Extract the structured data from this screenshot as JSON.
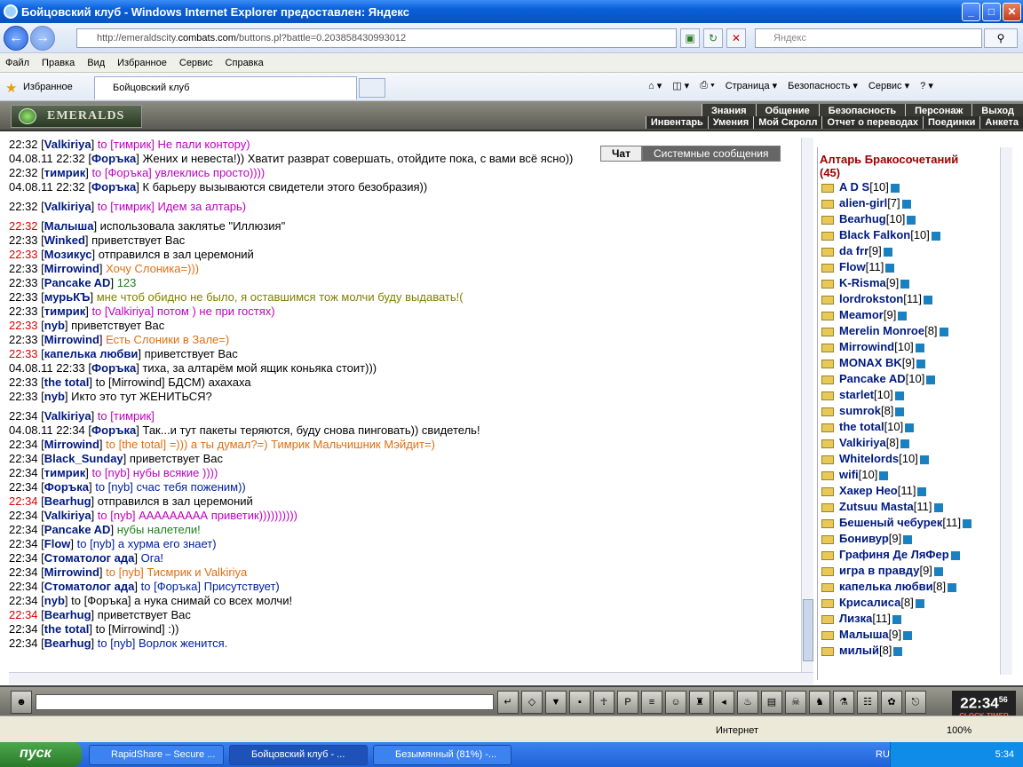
{
  "window": {
    "title": "Бойцовский клуб - Windows Internet Explorer предоставлен: Яндекс",
    "url_prefix": "http://emeraldscity.",
    "url_domain": "combats.com",
    "url_suffix": "/buttons.pl?battle=0.203858430993012",
    "search_placeholder": "Яндекс"
  },
  "menu": [
    "Файл",
    "Правка",
    "Вид",
    "Избранное",
    "Сервис",
    "Справка"
  ],
  "favorites_label": "Избранное",
  "tab_label": "Бойцовский клуб",
  "cmdbar": [
    "Страница ▾",
    "Безопасность ▾",
    "Сервис ▾"
  ],
  "game": {
    "logo": "EMERALDS",
    "menu1": [
      "Знания",
      "Общение",
      "Безопасность",
      "Персонаж",
      "Выход"
    ],
    "menu2": [
      "Инвентарь",
      "Умения",
      "Мой Скролл",
      "Отчет о переводах",
      "Поединки",
      "Анкета"
    ],
    "tabs": [
      "Чат",
      "Системные сообщения"
    ]
  },
  "chat": [
    {
      "t": "22:32",
      "r": false,
      "nick": "Valkiriya",
      "to": "to [тимрик]",
      "msg": "Не пали контору)",
      "mc": "#c000c0"
    },
    {
      "t": "04.08.11 22:32",
      "r": false,
      "nick": "Форъка",
      "to": "",
      "msg": "Жених и невеста!)) Хватит разврат совершать, отойдите пока, с вами всё ясно))",
      "mc": "#000"
    },
    {
      "t": "22:32",
      "r": false,
      "nick": "тимрик",
      "to": "to [Форъка]",
      "msg": "увлеклись просто))))",
      "mc": "#c000c0"
    },
    {
      "t": "04.08.11 22:32",
      "r": false,
      "nick": "Форъка",
      "to": "",
      "msg": "К барьеру вызываются свидетели этого безобразия))",
      "mc": "#000"
    },
    {
      "t": "22:32",
      "r": false,
      "nick": "Valkiriya",
      "to": "to [тимрик]",
      "msg": "Идем за алтарь)",
      "mc": "#c000c0",
      "gap": true
    },
    {
      "t": "22:32",
      "r": true,
      "nick": "Малыша",
      "to": "",
      "msg": "использовала заклятье \"Иллюзия\"",
      "mc": "#000",
      "gap": true
    },
    {
      "t": "22:33",
      "r": false,
      "nick": "Winked",
      "to": "",
      "msg": "приветствует Вас",
      "mc": "#000"
    },
    {
      "t": "22:33",
      "r": true,
      "nick": "Мозикус",
      "to": "",
      "msg": "отправился в зал церемоний",
      "mc": "#000"
    },
    {
      "t": "22:33",
      "r": false,
      "nick": "Mirrowind",
      "to": "",
      "msg": "Хочу Слоника=)))",
      "mc": "#e07010"
    },
    {
      "t": "22:33",
      "r": false,
      "nick": "Pancake AD",
      "to": "",
      "msg": "123",
      "mc": "#208020"
    },
    {
      "t": "22:33",
      "r": false,
      "nick": "мурьКЪ",
      "to": "",
      "msg": "мне чтоб обидно не было, я оставшимся тож молчи буду выдавать!(",
      "mc": "#808000"
    },
    {
      "t": "22:33",
      "r": false,
      "nick": "тимрик",
      "to": "to [Valkiriya]",
      "msg": "потом ) не при гостях)",
      "mc": "#c000c0"
    },
    {
      "t": "22:33",
      "r": true,
      "nick": "nyb",
      "to": "",
      "msg": "приветствует Вас",
      "mc": "#000"
    },
    {
      "t": "22:33",
      "r": false,
      "nick": "Mirrowind",
      "to": "",
      "msg": "Есть Слоники в Зале=)",
      "mc": "#e07010"
    },
    {
      "t": "22:33",
      "r": true,
      "nick": "капелька любви",
      "to": "",
      "msg": "приветствует Вас",
      "mc": "#000"
    },
    {
      "t": "04.08.11 22:33",
      "r": false,
      "nick": "Форъка",
      "to": "",
      "msg": "тиха, за алтарём мой ящик коньяка стоит)))",
      "mc": "#000"
    },
    {
      "t": "22:33",
      "r": false,
      "nick": "the total",
      "to": "to [Mirrowind]",
      "msg": "БДСМ) ахахаха",
      "mc": "#000"
    },
    {
      "t": "22:33",
      "r": false,
      "nick": "nyb",
      "to": "",
      "msg": "Икто это тут ЖЕНИТЬСЯ?",
      "mc": "#000"
    },
    {
      "t": "22:34",
      "r": false,
      "nick": "Valkiriya",
      "to": "to [тимрик]",
      "msg": "",
      "mc": "#c000c0",
      "gap": true
    },
    {
      "t": "04.08.11 22:34",
      "r": false,
      "nick": "Форъка",
      "to": "",
      "msg": "Так...и тут пакеты теряются, буду снова пинговать)) свидетель!",
      "mc": "#000"
    },
    {
      "t": "22:34",
      "r": false,
      "nick": "Mirrowind",
      "to": "to [the total]",
      "msg": "=))) а ты думал?=) Тимрик Мальчишник Мэйдит=)",
      "mc": "#e07010"
    },
    {
      "t": "22:34",
      "r": false,
      "nick": "Black_Sunday",
      "to": "",
      "msg": "приветствует Вас",
      "mc": "#000"
    },
    {
      "t": "22:34",
      "r": false,
      "nick": "тимрик",
      "to": "to [nyb]",
      "msg": "нубы всякие ))))",
      "mc": "#c000c0"
    },
    {
      "t": "22:34",
      "r": false,
      "nick": "Форъка",
      "to": "to [nyb]",
      "msg": "счас тебя поженим))",
      "mc": "#0020a0"
    },
    {
      "t": "22:34",
      "r": true,
      "nick": "Bearhug",
      "to": "",
      "msg": "отправился в зал церемоний",
      "mc": "#000"
    },
    {
      "t": "22:34",
      "r": false,
      "nick": "Valkiriya",
      "to": "to [nyb]",
      "msg": "ААААААААА приветик))))))))))",
      "mc": "#c000c0"
    },
    {
      "t": "22:34",
      "r": false,
      "nick": "Pancake AD",
      "to": "",
      "msg": "нубы налетели!",
      "mc": "#208020"
    },
    {
      "t": "22:34",
      "r": false,
      "nick": "Flow",
      "to": "to [nyb]",
      "msg": "а хурма его знает)",
      "mc": "#0020a0"
    },
    {
      "t": "22:34",
      "r": false,
      "nick": "Стоматолог ада",
      "to": "",
      "msg": "Ога!",
      "mc": "#0020a0"
    },
    {
      "t": "22:34",
      "r": false,
      "nick": "Mirrowind",
      "to": "to [nyb]",
      "msg": "Тисмрик и Valkiriya",
      "mc": "#e07010"
    },
    {
      "t": "22:34",
      "r": false,
      "nick": "Стоматолог ада",
      "to": "to [Форъка]",
      "msg": "Присутствует)",
      "mc": "#0020a0"
    },
    {
      "t": "22:34",
      "r": false,
      "nick": "nyb",
      "to": "to [Форъка]",
      "msg": "а нука снимай со всех молчи!",
      "mc": "#000"
    },
    {
      "t": "22:34",
      "r": true,
      "nick": "Bearhug",
      "to": "",
      "msg": "приветствует Вас",
      "mc": "#000"
    },
    {
      "t": "22:34",
      "r": false,
      "nick": "the total",
      "to": "to [Mirrowind]",
      "msg": ":))",
      "mc": "#000"
    },
    {
      "t": "22:34",
      "r": false,
      "nick": "Bearhug",
      "to": "to [nyb]",
      "msg": "Ворлок женится.",
      "mc": "#0020a0"
    }
  ],
  "room": {
    "title": "Алтарь Бракосочетаний",
    "count": "(45)",
    "players": [
      {
        "name": "A D S",
        "lvl": "[10]"
      },
      {
        "name": "alien-girl",
        "lvl": "[7]"
      },
      {
        "name": "Bearhug",
        "lvl": "[10]"
      },
      {
        "name": "Black Falkon",
        "lvl": "[10]"
      },
      {
        "name": "da frr",
        "lvl": "[9]"
      },
      {
        "name": "Flow",
        "lvl": "[11]"
      },
      {
        "name": "K-Risma",
        "lvl": "[9]"
      },
      {
        "name": "lordrokston",
        "lvl": "[11]"
      },
      {
        "name": "Meamor",
        "lvl": "[9]"
      },
      {
        "name": "Merelin Monroe",
        "lvl": "[8]"
      },
      {
        "name": "Mirrowind",
        "lvl": "[10]"
      },
      {
        "name": "MONAX BK",
        "lvl": "[9]"
      },
      {
        "name": "Pancake AD",
        "lvl": "[10]"
      },
      {
        "name": "starlet",
        "lvl": "[10]"
      },
      {
        "name": "sumrok",
        "lvl": "[8]"
      },
      {
        "name": "the total",
        "lvl": "[10]"
      },
      {
        "name": "Valkiriya",
        "lvl": "[8]"
      },
      {
        "name": "Whitelords",
        "lvl": "[10]"
      },
      {
        "name": "wifi",
        "lvl": "[10]"
      },
      {
        "name": "Хакер Нео",
        "lvl": "[11]"
      },
      {
        "name": "Zutsuu Masta",
        "lvl": "[11]"
      },
      {
        "name": "Бешеный чебурек",
        "lvl": "[11]"
      },
      {
        "name": "Бонивур",
        "lvl": "[9]"
      },
      {
        "name": "Графиня Де ЛяФер",
        "lvl": ""
      },
      {
        "name": "игра в правду",
        "lvl": "[9]"
      },
      {
        "name": "капелька любви",
        "lvl": "[8]"
      },
      {
        "name": "Крисалиса",
        "lvl": "[8]"
      },
      {
        "name": "Лизка",
        "lvl": "[11]"
      },
      {
        "name": "Малыша",
        "lvl": "[9]"
      },
      {
        "name": "милый",
        "lvl": "[8]"
      }
    ]
  },
  "clock": {
    "time": "22:34",
    "sec": "56",
    "labels": "CLOCK TIMER"
  },
  "status": {
    "net": "Интернет",
    "zoom": "100%"
  },
  "taskbar": {
    "start": "пуск",
    "tasks": [
      "RapidShare – Secure ...",
      "Бойцовский клуб - ...",
      "Безымянный (81%) -..."
    ],
    "lang": "RU",
    "time": "5:34"
  }
}
